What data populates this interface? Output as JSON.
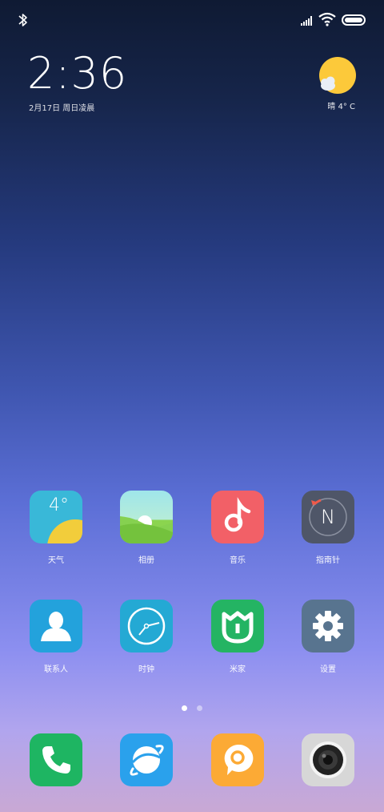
{
  "lockscreen": {
    "time": "2:36",
    "date": "2月17日 周日凌晨",
    "weather": {
      "temp": "晴  4°  C",
      "icon": "sun-cloud-icon"
    }
  },
  "pages": {
    "count": 2,
    "active_index": 0
  },
  "apps": [
    {
      "id": "weather",
      "label": "天气",
      "tile_text": "4°",
      "color": "#39b8d8"
    },
    {
      "id": "gallery",
      "label": "相册",
      "color": "#7ccf57"
    },
    {
      "id": "music",
      "label": "音乐",
      "color": "#f26067"
    },
    {
      "id": "compass",
      "label": "指南针",
      "tile_text": "N",
      "color": "#4f5668"
    },
    {
      "id": "contacts",
      "label": "联系人",
      "color": "#23a2dc"
    },
    {
      "id": "clock",
      "label": "时钟",
      "color": "#24a9d4"
    },
    {
      "id": "mijia",
      "label": "米家",
      "color": "#24b463"
    },
    {
      "id": "settings",
      "label": "设置",
      "color": "#58748f"
    }
  ],
  "dock": [
    {
      "id": "phone",
      "icon": "phone-icon",
      "color": "#1eb562"
    },
    {
      "id": "browser",
      "icon": "browser-icon",
      "color": "#2aa1ec"
    },
    {
      "id": "messages",
      "icon": "message-icon",
      "color": "#fcaa35"
    },
    {
      "id": "camera",
      "icon": "camera-icon",
      "color": "#d7d7d7"
    }
  ]
}
